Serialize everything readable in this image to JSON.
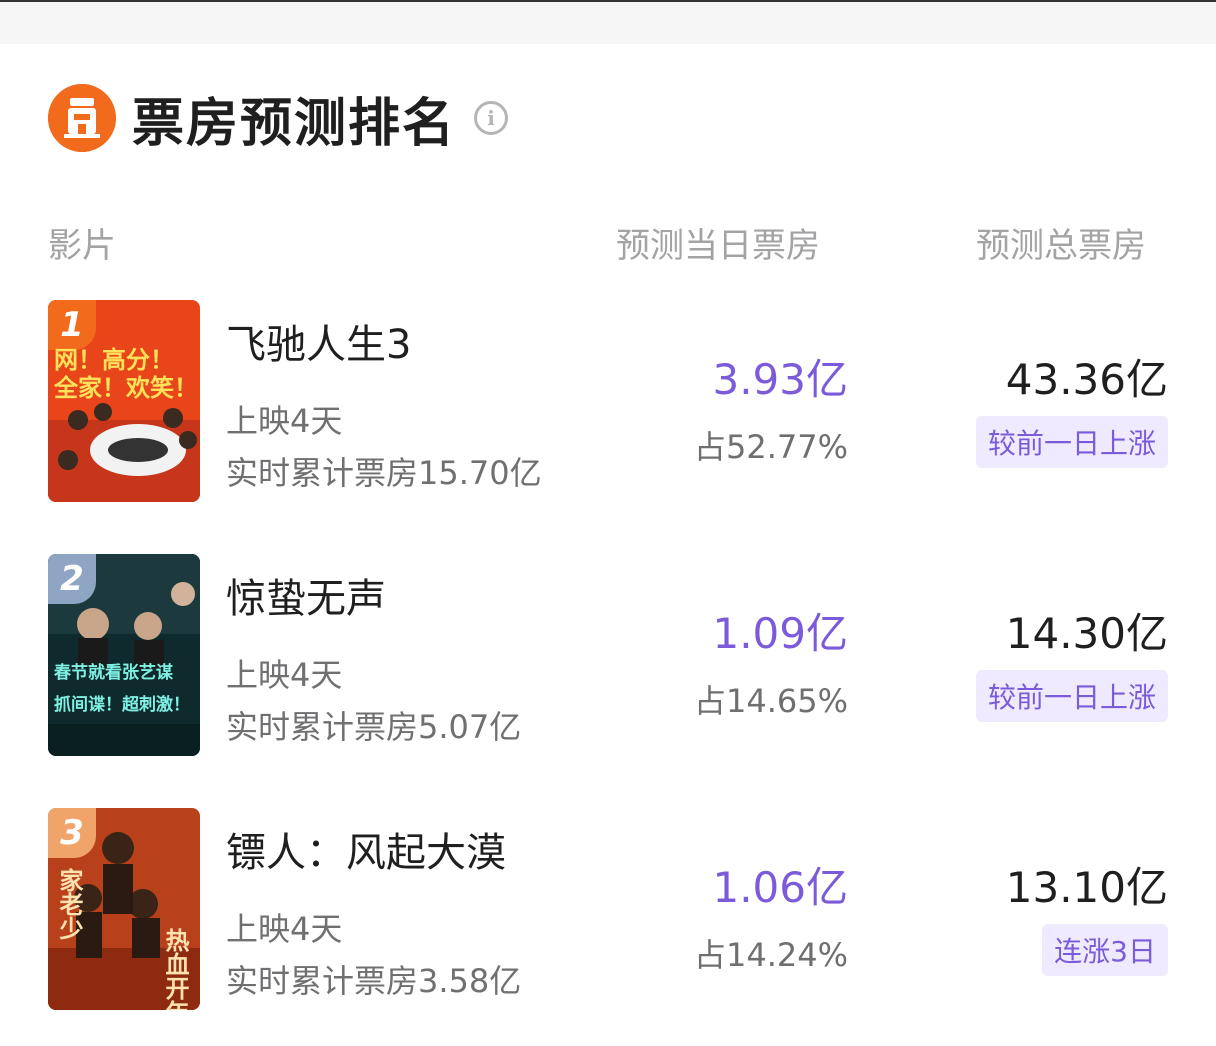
{
  "header": {
    "title": "票房预测排名",
    "info_icon": "info-icon",
    "logo_icon": "cinema-logo-icon",
    "accent_color": "#f26a1b"
  },
  "columns": {
    "film": "影片",
    "day_forecast": "预测当日票房",
    "total_forecast": "预测总票房"
  },
  "films": [
    {
      "rank": "1",
      "name": "飞驰人生3",
      "days": "上映4天",
      "live_total": "实时累计票房15.70亿",
      "day_value": "3.93亿",
      "day_share": "占52.77%",
      "total_value": "43.36亿",
      "trend": "较前一日上涨",
      "poster_line1": "网！高分！",
      "poster_line2": "全家！欢笑！",
      "rank_color": "#f26a1b"
    },
    {
      "rank": "2",
      "name": "惊蛰无声",
      "days": "上映4天",
      "live_total": "实时累计票房5.07亿",
      "day_value": "1.09亿",
      "day_share": "占14.65%",
      "total_value": "14.30亿",
      "trend": "较前一日上涨",
      "poster_line1": "春节就看张艺谋",
      "poster_line2": "抓间谍！超刺激！",
      "rank_color": "#8ea6c4"
    },
    {
      "rank": "3",
      "name": "镖人：风起大漠",
      "days": "上映4天",
      "live_total": "实时累计票房3.58亿",
      "day_value": "1.06亿",
      "day_share": "占14.24%",
      "total_value": "13.10亿",
      "trend": "连涨3日",
      "poster_line1": "热血开年",
      "poster_line2": "家老少",
      "rank_color": "#f0a46a"
    }
  ]
}
